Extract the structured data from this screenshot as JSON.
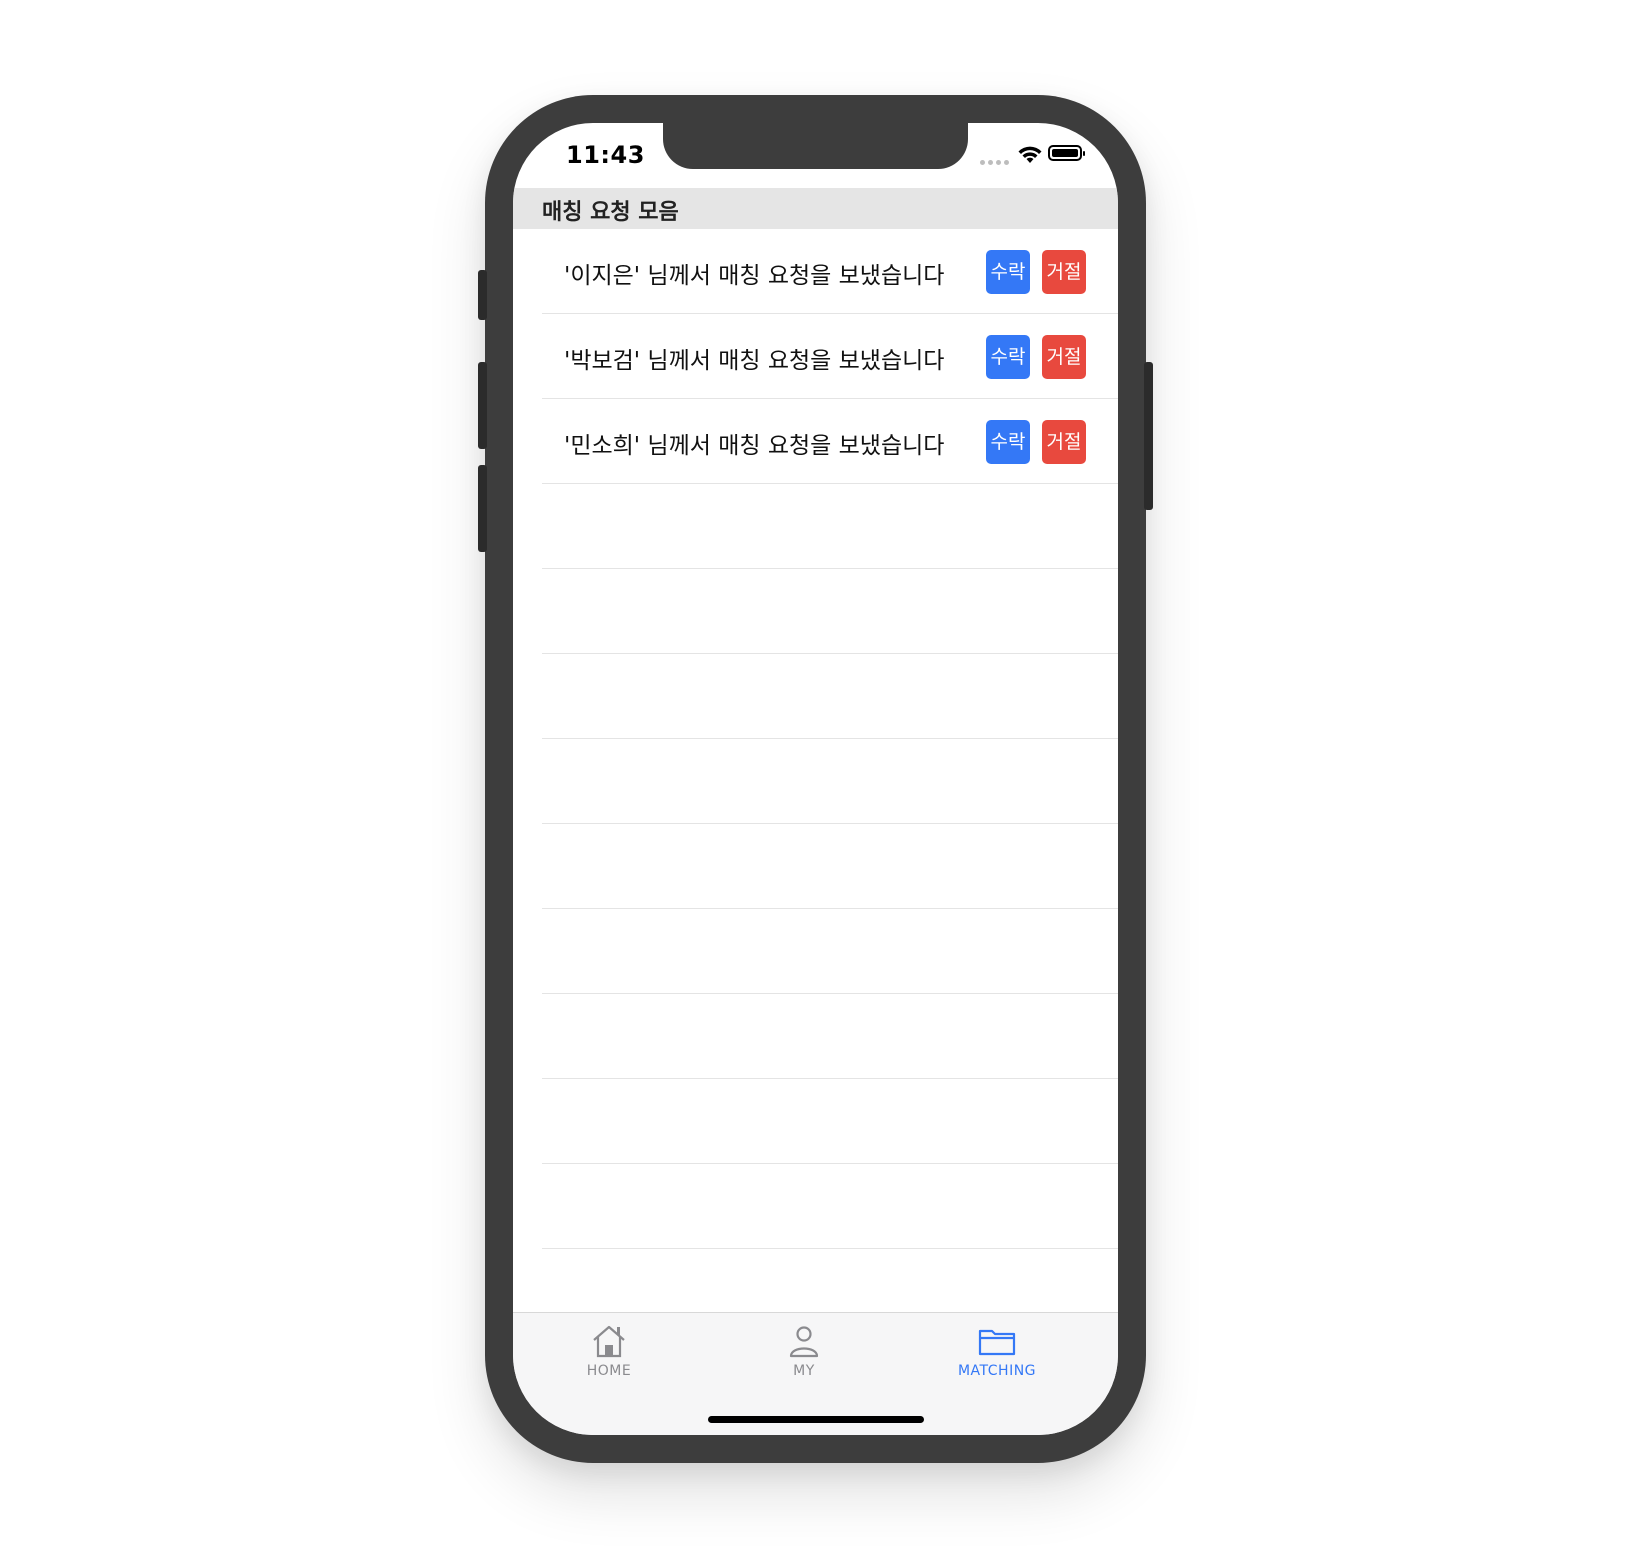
{
  "status_bar": {
    "time": "11:43"
  },
  "header": {
    "title": "매칭 요청 모음"
  },
  "requests": [
    {
      "text": "'이지은' 님께서 매칭 요청을 보냈습니다",
      "accept_label": "수락",
      "reject_label": "거절"
    },
    {
      "text": "'박보검' 님께서 매칭 요청을 보냈습니다",
      "accept_label": "수락",
      "reject_label": "거절"
    },
    {
      "text": "'민소희' 님께서 매칭 요청을 보냈습니다",
      "accept_label": "수락",
      "reject_label": "거절"
    }
  ],
  "empty_rows": 9,
  "tabbar": {
    "tabs": [
      {
        "label": "HOME",
        "icon": "home-icon",
        "active": false
      },
      {
        "label": "MY",
        "icon": "person-icon",
        "active": false
      },
      {
        "label": "MATCHING",
        "icon": "folder-icon",
        "active": true
      }
    ]
  },
  "colors": {
    "accept": "#3478f6",
    "reject": "#e8493e",
    "tab_active": "#3478f6",
    "tab_inactive": "#8a8a8e",
    "header_bg": "#e5e5e5"
  }
}
